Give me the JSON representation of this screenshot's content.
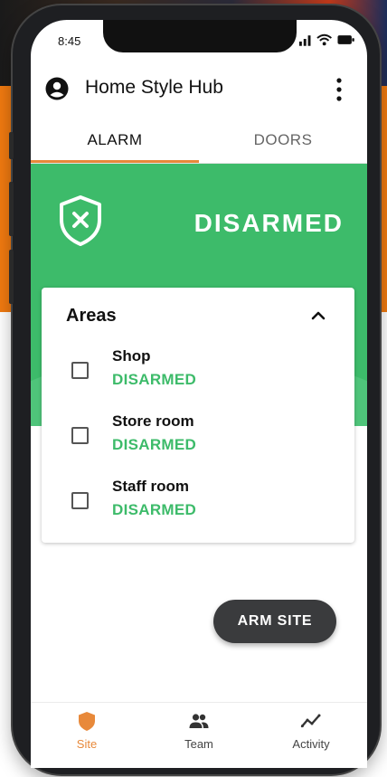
{
  "status_bar": {
    "time": "8:45"
  },
  "app": {
    "title": "Home Style Hub"
  },
  "tabs": [
    {
      "label": "ALARM",
      "active": true
    },
    {
      "label": "DOORS",
      "active": false
    }
  ],
  "hero": {
    "status": "DISARMED",
    "icon": "shield-x-icon"
  },
  "areas_card": {
    "title": "Areas",
    "expanded": true,
    "items": [
      {
        "name": "Shop",
        "status": "DISARMED",
        "checked": false
      },
      {
        "name": "Store room",
        "status": "DISARMED",
        "checked": false
      },
      {
        "name": "Staff room",
        "status": "DISARMED",
        "checked": false
      }
    ]
  },
  "actions": {
    "arm_site_label": "ARM SITE"
  },
  "bottom_nav": [
    {
      "label": "Site",
      "icon": "shield-icon",
      "active": true
    },
    {
      "label": "Team",
      "icon": "team-icon",
      "active": false
    },
    {
      "label": "Activity",
      "icon": "activity-icon",
      "active": false
    }
  ],
  "colors": {
    "accent": "#e8893a",
    "status_green": "#3dbb6a",
    "button_dark": "#3a3b3d"
  }
}
